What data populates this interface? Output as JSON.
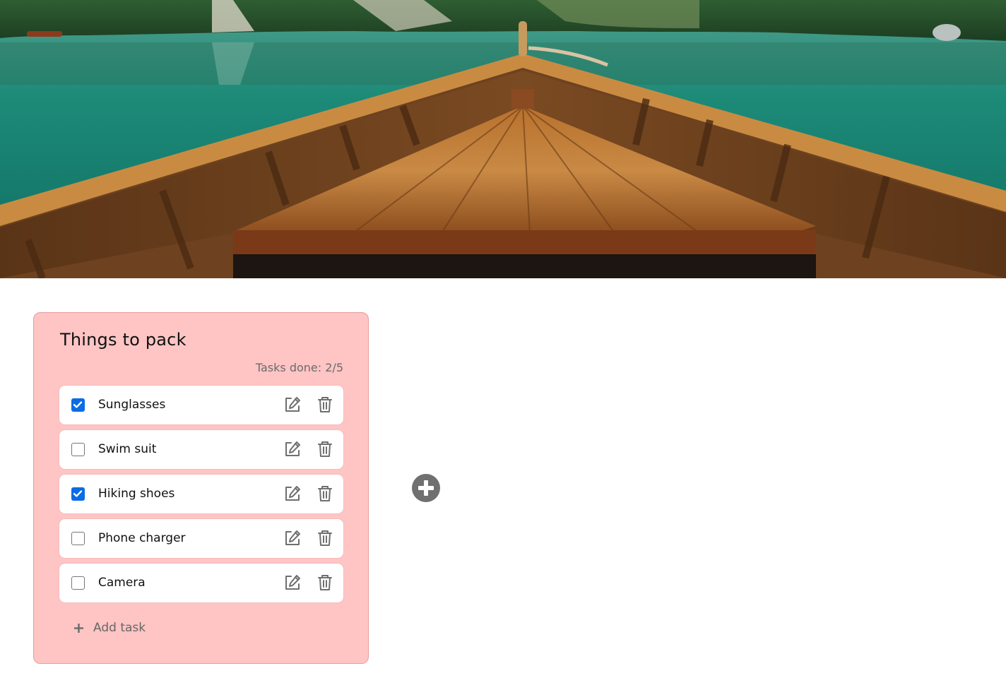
{
  "hero": {
    "image": "boat-bow-on-lake-photo"
  },
  "list": {
    "title": "Things to pack",
    "tasks_done_label": "Tasks done:",
    "tasks_done_value": "2/5",
    "tasks": [
      {
        "label": "Sunglasses",
        "checked": true
      },
      {
        "label": "Swim suit",
        "checked": false
      },
      {
        "label": "Hiking shoes",
        "checked": true
      },
      {
        "label": "Phone charger",
        "checked": false
      },
      {
        "label": "Camera",
        "checked": false
      }
    ],
    "add_task_label": "Add task"
  },
  "icons": {
    "edit": "edit-icon",
    "delete": "trash-icon",
    "add_task": "plus-icon",
    "add_list": "plus-circle-icon"
  },
  "colors": {
    "card_background": "#ffc4c4",
    "checkbox_checked": "#0b6ce6",
    "add_list_button": "#707070",
    "muted_text": "#6b6b6b"
  }
}
